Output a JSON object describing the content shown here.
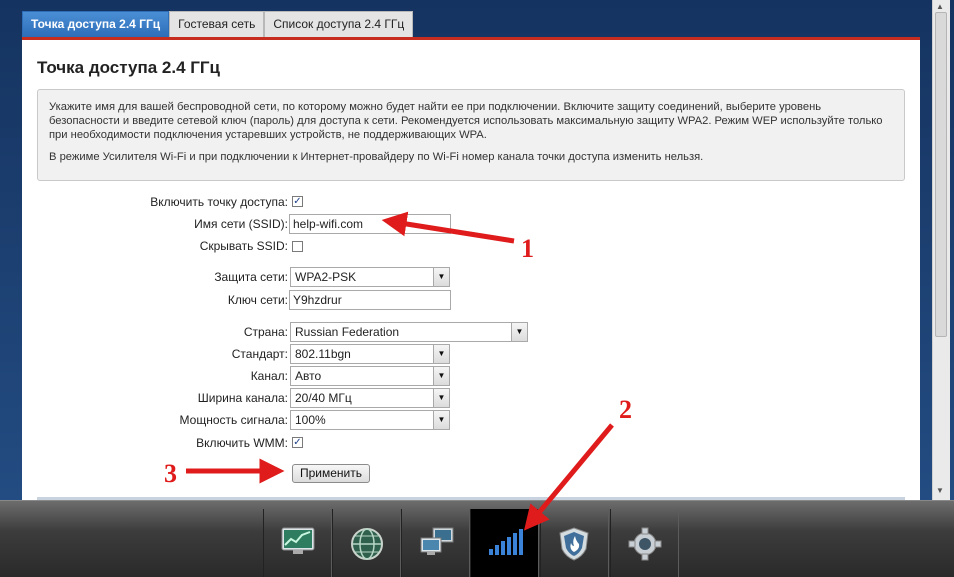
{
  "tabs": [
    {
      "label": "Точка доступа 2.4 ГГц"
    },
    {
      "label": "Гостевая сеть"
    },
    {
      "label": "Список доступа 2.4 ГГц"
    }
  ],
  "page_title": "Точка доступа 2.4 ГГц",
  "info": {
    "p1": "Укажите имя для вашей беспроводной сети, по которому можно будет найти ее при подключении. Включите защиту соединений, выберите уровень безопасности и введите сетевой ключ (пароль) для доступа к сети. Рекомендуется использовать максимальную защиту WPA2. Режим WEP используйте только при необходимости подключения устаревших устройств, не поддерживающих WPA.",
    "p2": "В режиме Усилителя Wi-Fi и при подключении к Интернет-провайдеру по Wi-Fi номер канала точки доступа изменить нельзя."
  },
  "form": {
    "enable_ap": {
      "label": "Включить точку доступа:",
      "checked": true
    },
    "ssid": {
      "label": "Имя сети (SSID):",
      "value": "help-wifi.com"
    },
    "hide_ssid": {
      "label": "Скрывать SSID:",
      "checked": false
    },
    "security": {
      "label": "Защита сети:",
      "value": "WPA2-PSK"
    },
    "key": {
      "label": "Ключ сети:",
      "value": "Y9hzdrur"
    },
    "country": {
      "label": "Страна:",
      "value": "Russian Federation"
    },
    "standard": {
      "label": "Стандарт:",
      "value": "802.11bgn"
    },
    "channel": {
      "label": "Канал:",
      "value": "Авто"
    },
    "width": {
      "label": "Ширина канала:",
      "value": "20/40 МГц"
    },
    "power": {
      "label": "Мощность сигнала:",
      "value": "100%"
    },
    "wmm": {
      "label": "Включить WMM:",
      "checked": true
    },
    "apply_label": "Применить"
  },
  "annotations": {
    "n1": "1",
    "n2": "2",
    "n3": "3",
    "color": "#e01b1b"
  },
  "toolbar": {
    "icons": [
      "monitor-chart-icon",
      "globe-icon",
      "network-computers-icon",
      "wifi-signal-icon",
      "shield-flame-icon",
      "gear-icon"
    ],
    "active_index": 3
  }
}
